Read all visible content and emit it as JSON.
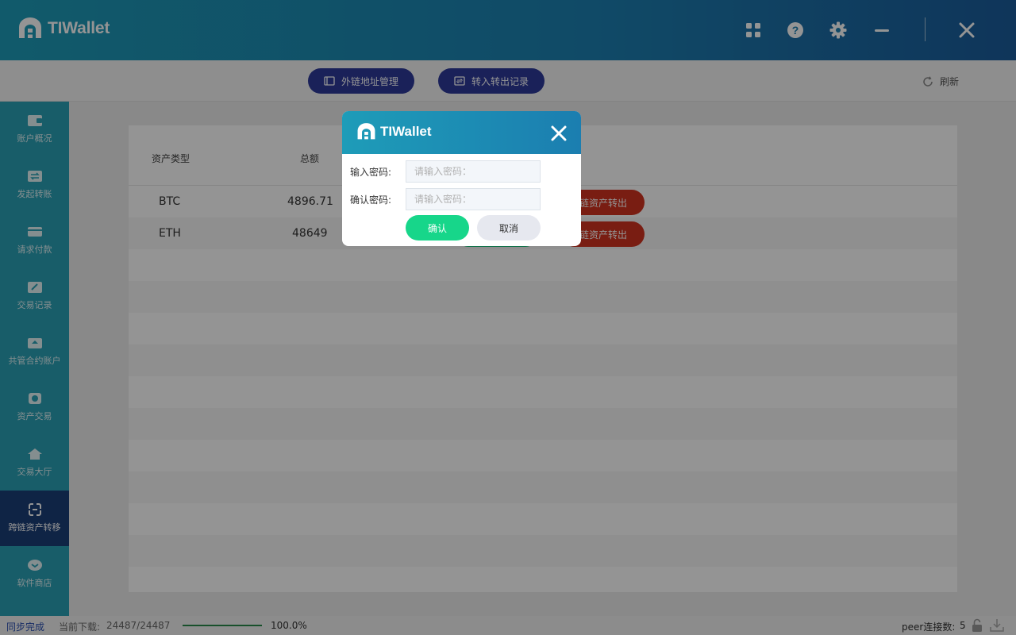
{
  "header": {
    "app_title": "TIWallet",
    "icons": [
      "grid-icon",
      "help-icon",
      "gear-icon",
      "minimize-icon",
      "close-icon"
    ]
  },
  "toolbar": {
    "external_address_label": "外链地址管理",
    "transfer_records_label": "转入转出记录",
    "refresh_label": "刷新"
  },
  "sidebar": {
    "items": [
      {
        "label": "账户概况",
        "icon": "wallet-icon"
      },
      {
        "label": "发起转账",
        "icon": "transfer-icon"
      },
      {
        "label": "请求付款",
        "icon": "card-icon"
      },
      {
        "label": "交易记录",
        "icon": "edit-icon"
      },
      {
        "label": "共管合约账户",
        "icon": "vault-icon"
      },
      {
        "label": "资产交易",
        "icon": "coin-icon"
      },
      {
        "label": "交易大厅",
        "icon": "home-icon"
      },
      {
        "label": "跨链资产转移",
        "icon": "crosschain-icon"
      },
      {
        "label": "软件商店",
        "icon": "store-icon"
      }
    ],
    "active_index": 7
  },
  "table": {
    "headers": [
      "资产类型",
      "总额"
    ],
    "rows": [
      {
        "type": "BTC",
        "total": "4896.71",
        "action_label": "链资产转出"
      },
      {
        "type": "ETH",
        "total": "48649",
        "action_label": "链资产转出"
      }
    ]
  },
  "statusbar": {
    "sync_status": "同步完成",
    "download_label": "当前下载:",
    "download_value": "24487/24487",
    "progress_percent": "100.0%",
    "progress_fraction": 1.0,
    "peer_label": "peer连接数:",
    "peer_count": "5"
  },
  "dialog": {
    "title": "TIWallet",
    "password_label": "输入密码:",
    "password_placeholder": "请输入密码：",
    "confirm_password_label": "确认密码:",
    "confirm_password_placeholder": "请输入密码：",
    "confirm_label": "确认",
    "cancel_label": "取消"
  },
  "colors": {
    "header_start": "#1e9cb8",
    "header_end": "#1a5c9c",
    "toolbar_button": "#2d3a9a",
    "sidebar": "#2aa0b5",
    "sidebar_active": "#1a3e78",
    "danger": "#d0331f",
    "success": "#17c47a"
  }
}
